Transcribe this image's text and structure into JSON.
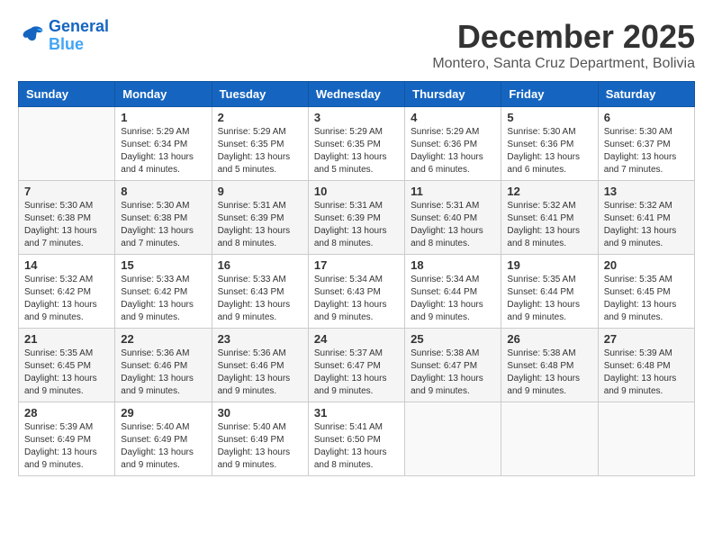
{
  "logo": {
    "line1": "General",
    "line2": "Blue"
  },
  "title": "December 2025",
  "location": "Montero, Santa Cruz Department, Bolivia",
  "days_of_week": [
    "Sunday",
    "Monday",
    "Tuesday",
    "Wednesday",
    "Thursday",
    "Friday",
    "Saturday"
  ],
  "weeks": [
    [
      {
        "day": "",
        "info": ""
      },
      {
        "day": "1",
        "info": "Sunrise: 5:29 AM\nSunset: 6:34 PM\nDaylight: 13 hours\nand 4 minutes."
      },
      {
        "day": "2",
        "info": "Sunrise: 5:29 AM\nSunset: 6:35 PM\nDaylight: 13 hours\nand 5 minutes."
      },
      {
        "day": "3",
        "info": "Sunrise: 5:29 AM\nSunset: 6:35 PM\nDaylight: 13 hours\nand 5 minutes."
      },
      {
        "day": "4",
        "info": "Sunrise: 5:29 AM\nSunset: 6:36 PM\nDaylight: 13 hours\nand 6 minutes."
      },
      {
        "day": "5",
        "info": "Sunrise: 5:30 AM\nSunset: 6:36 PM\nDaylight: 13 hours\nand 6 minutes."
      },
      {
        "day": "6",
        "info": "Sunrise: 5:30 AM\nSunset: 6:37 PM\nDaylight: 13 hours\nand 7 minutes."
      }
    ],
    [
      {
        "day": "7",
        "info": "Sunrise: 5:30 AM\nSunset: 6:38 PM\nDaylight: 13 hours\nand 7 minutes."
      },
      {
        "day": "8",
        "info": "Sunrise: 5:30 AM\nSunset: 6:38 PM\nDaylight: 13 hours\nand 7 minutes."
      },
      {
        "day": "9",
        "info": "Sunrise: 5:31 AM\nSunset: 6:39 PM\nDaylight: 13 hours\nand 8 minutes."
      },
      {
        "day": "10",
        "info": "Sunrise: 5:31 AM\nSunset: 6:39 PM\nDaylight: 13 hours\nand 8 minutes."
      },
      {
        "day": "11",
        "info": "Sunrise: 5:31 AM\nSunset: 6:40 PM\nDaylight: 13 hours\nand 8 minutes."
      },
      {
        "day": "12",
        "info": "Sunrise: 5:32 AM\nSunset: 6:41 PM\nDaylight: 13 hours\nand 8 minutes."
      },
      {
        "day": "13",
        "info": "Sunrise: 5:32 AM\nSunset: 6:41 PM\nDaylight: 13 hours\nand 9 minutes."
      }
    ],
    [
      {
        "day": "14",
        "info": "Sunrise: 5:32 AM\nSunset: 6:42 PM\nDaylight: 13 hours\nand 9 minutes."
      },
      {
        "day": "15",
        "info": "Sunrise: 5:33 AM\nSunset: 6:42 PM\nDaylight: 13 hours\nand 9 minutes."
      },
      {
        "day": "16",
        "info": "Sunrise: 5:33 AM\nSunset: 6:43 PM\nDaylight: 13 hours\nand 9 minutes."
      },
      {
        "day": "17",
        "info": "Sunrise: 5:34 AM\nSunset: 6:43 PM\nDaylight: 13 hours\nand 9 minutes."
      },
      {
        "day": "18",
        "info": "Sunrise: 5:34 AM\nSunset: 6:44 PM\nDaylight: 13 hours\nand 9 minutes."
      },
      {
        "day": "19",
        "info": "Sunrise: 5:35 AM\nSunset: 6:44 PM\nDaylight: 13 hours\nand 9 minutes."
      },
      {
        "day": "20",
        "info": "Sunrise: 5:35 AM\nSunset: 6:45 PM\nDaylight: 13 hours\nand 9 minutes."
      }
    ],
    [
      {
        "day": "21",
        "info": "Sunrise: 5:35 AM\nSunset: 6:45 PM\nDaylight: 13 hours\nand 9 minutes."
      },
      {
        "day": "22",
        "info": "Sunrise: 5:36 AM\nSunset: 6:46 PM\nDaylight: 13 hours\nand 9 minutes."
      },
      {
        "day": "23",
        "info": "Sunrise: 5:36 AM\nSunset: 6:46 PM\nDaylight: 13 hours\nand 9 minutes."
      },
      {
        "day": "24",
        "info": "Sunrise: 5:37 AM\nSunset: 6:47 PM\nDaylight: 13 hours\nand 9 minutes."
      },
      {
        "day": "25",
        "info": "Sunrise: 5:38 AM\nSunset: 6:47 PM\nDaylight: 13 hours\nand 9 minutes."
      },
      {
        "day": "26",
        "info": "Sunrise: 5:38 AM\nSunset: 6:48 PM\nDaylight: 13 hours\nand 9 minutes."
      },
      {
        "day": "27",
        "info": "Sunrise: 5:39 AM\nSunset: 6:48 PM\nDaylight: 13 hours\nand 9 minutes."
      }
    ],
    [
      {
        "day": "28",
        "info": "Sunrise: 5:39 AM\nSunset: 6:49 PM\nDaylight: 13 hours\nand 9 minutes."
      },
      {
        "day": "29",
        "info": "Sunrise: 5:40 AM\nSunset: 6:49 PM\nDaylight: 13 hours\nand 9 minutes."
      },
      {
        "day": "30",
        "info": "Sunrise: 5:40 AM\nSunset: 6:49 PM\nDaylight: 13 hours\nand 9 minutes."
      },
      {
        "day": "31",
        "info": "Sunrise: 5:41 AM\nSunset: 6:50 PM\nDaylight: 13 hours\nand 8 minutes."
      },
      {
        "day": "",
        "info": ""
      },
      {
        "day": "",
        "info": ""
      },
      {
        "day": "",
        "info": ""
      }
    ]
  ]
}
